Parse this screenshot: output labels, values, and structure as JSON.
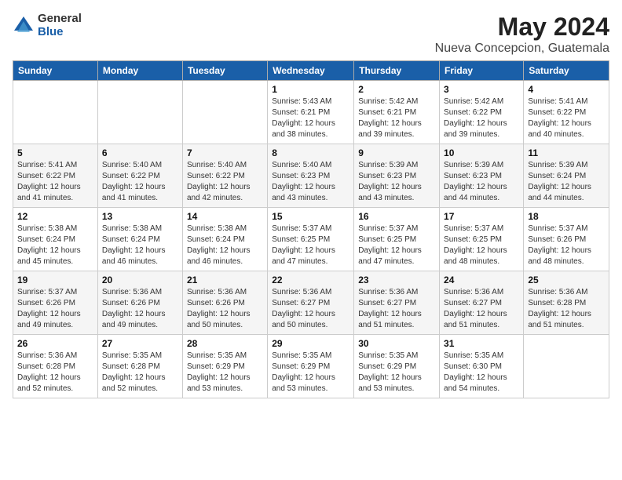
{
  "logo": {
    "general": "General",
    "blue": "Blue"
  },
  "title": {
    "month_year": "May 2024",
    "location": "Nueva Concepcion, Guatemala"
  },
  "days_header": [
    "Sunday",
    "Monday",
    "Tuesday",
    "Wednesday",
    "Thursday",
    "Friday",
    "Saturday"
  ],
  "weeks": [
    [
      {
        "day": "",
        "info": ""
      },
      {
        "day": "",
        "info": ""
      },
      {
        "day": "",
        "info": ""
      },
      {
        "day": "1",
        "info": "Sunrise: 5:43 AM\nSunset: 6:21 PM\nDaylight: 12 hours\nand 38 minutes."
      },
      {
        "day": "2",
        "info": "Sunrise: 5:42 AM\nSunset: 6:21 PM\nDaylight: 12 hours\nand 39 minutes."
      },
      {
        "day": "3",
        "info": "Sunrise: 5:42 AM\nSunset: 6:22 PM\nDaylight: 12 hours\nand 39 minutes."
      },
      {
        "day": "4",
        "info": "Sunrise: 5:41 AM\nSunset: 6:22 PM\nDaylight: 12 hours\nand 40 minutes."
      }
    ],
    [
      {
        "day": "5",
        "info": "Sunrise: 5:41 AM\nSunset: 6:22 PM\nDaylight: 12 hours\nand 41 minutes."
      },
      {
        "day": "6",
        "info": "Sunrise: 5:40 AM\nSunset: 6:22 PM\nDaylight: 12 hours\nand 41 minutes."
      },
      {
        "day": "7",
        "info": "Sunrise: 5:40 AM\nSunset: 6:22 PM\nDaylight: 12 hours\nand 42 minutes."
      },
      {
        "day": "8",
        "info": "Sunrise: 5:40 AM\nSunset: 6:23 PM\nDaylight: 12 hours\nand 43 minutes."
      },
      {
        "day": "9",
        "info": "Sunrise: 5:39 AM\nSunset: 6:23 PM\nDaylight: 12 hours\nand 43 minutes."
      },
      {
        "day": "10",
        "info": "Sunrise: 5:39 AM\nSunset: 6:23 PM\nDaylight: 12 hours\nand 44 minutes."
      },
      {
        "day": "11",
        "info": "Sunrise: 5:39 AM\nSunset: 6:24 PM\nDaylight: 12 hours\nand 44 minutes."
      }
    ],
    [
      {
        "day": "12",
        "info": "Sunrise: 5:38 AM\nSunset: 6:24 PM\nDaylight: 12 hours\nand 45 minutes."
      },
      {
        "day": "13",
        "info": "Sunrise: 5:38 AM\nSunset: 6:24 PM\nDaylight: 12 hours\nand 46 minutes."
      },
      {
        "day": "14",
        "info": "Sunrise: 5:38 AM\nSunset: 6:24 PM\nDaylight: 12 hours\nand 46 minutes."
      },
      {
        "day": "15",
        "info": "Sunrise: 5:37 AM\nSunset: 6:25 PM\nDaylight: 12 hours\nand 47 minutes."
      },
      {
        "day": "16",
        "info": "Sunrise: 5:37 AM\nSunset: 6:25 PM\nDaylight: 12 hours\nand 47 minutes."
      },
      {
        "day": "17",
        "info": "Sunrise: 5:37 AM\nSunset: 6:25 PM\nDaylight: 12 hours\nand 48 minutes."
      },
      {
        "day": "18",
        "info": "Sunrise: 5:37 AM\nSunset: 6:26 PM\nDaylight: 12 hours\nand 48 minutes."
      }
    ],
    [
      {
        "day": "19",
        "info": "Sunrise: 5:37 AM\nSunset: 6:26 PM\nDaylight: 12 hours\nand 49 minutes."
      },
      {
        "day": "20",
        "info": "Sunrise: 5:36 AM\nSunset: 6:26 PM\nDaylight: 12 hours\nand 49 minutes."
      },
      {
        "day": "21",
        "info": "Sunrise: 5:36 AM\nSunset: 6:26 PM\nDaylight: 12 hours\nand 50 minutes."
      },
      {
        "day": "22",
        "info": "Sunrise: 5:36 AM\nSunset: 6:27 PM\nDaylight: 12 hours\nand 50 minutes."
      },
      {
        "day": "23",
        "info": "Sunrise: 5:36 AM\nSunset: 6:27 PM\nDaylight: 12 hours\nand 51 minutes."
      },
      {
        "day": "24",
        "info": "Sunrise: 5:36 AM\nSunset: 6:27 PM\nDaylight: 12 hours\nand 51 minutes."
      },
      {
        "day": "25",
        "info": "Sunrise: 5:36 AM\nSunset: 6:28 PM\nDaylight: 12 hours\nand 51 minutes."
      }
    ],
    [
      {
        "day": "26",
        "info": "Sunrise: 5:36 AM\nSunset: 6:28 PM\nDaylight: 12 hours\nand 52 minutes."
      },
      {
        "day": "27",
        "info": "Sunrise: 5:35 AM\nSunset: 6:28 PM\nDaylight: 12 hours\nand 52 minutes."
      },
      {
        "day": "28",
        "info": "Sunrise: 5:35 AM\nSunset: 6:29 PM\nDaylight: 12 hours\nand 53 minutes."
      },
      {
        "day": "29",
        "info": "Sunrise: 5:35 AM\nSunset: 6:29 PM\nDaylight: 12 hours\nand 53 minutes."
      },
      {
        "day": "30",
        "info": "Sunrise: 5:35 AM\nSunset: 6:29 PM\nDaylight: 12 hours\nand 53 minutes."
      },
      {
        "day": "31",
        "info": "Sunrise: 5:35 AM\nSunset: 6:30 PM\nDaylight: 12 hours\nand 54 minutes."
      },
      {
        "day": "",
        "info": ""
      }
    ]
  ]
}
